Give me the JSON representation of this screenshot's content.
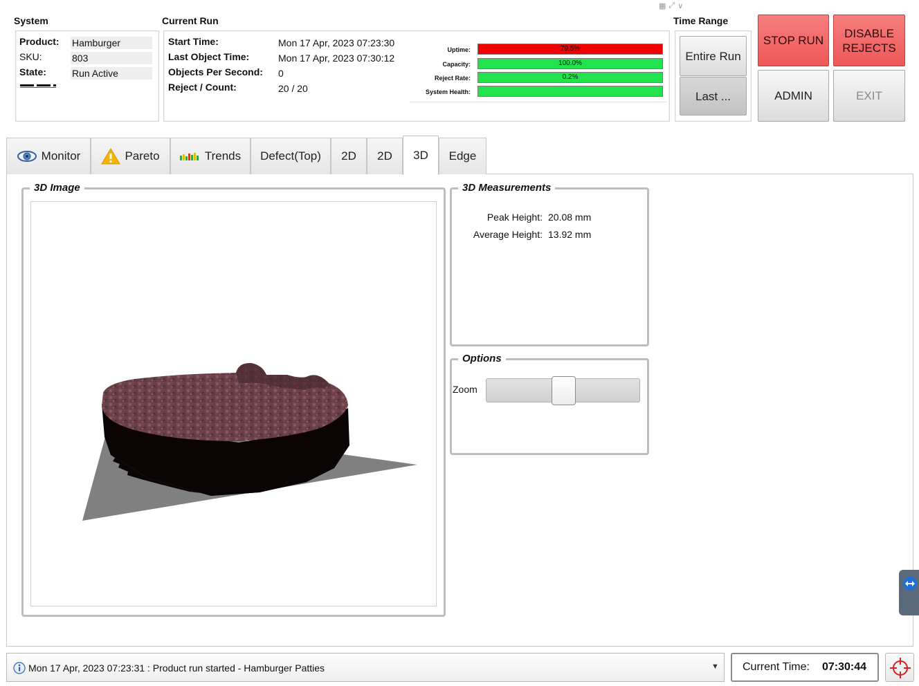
{
  "colors": {
    "accent_red": "#ee5757",
    "status_green": "#22e34d",
    "status_red": "#f00000",
    "panel_border": "#bdbdbd"
  },
  "system": {
    "title": "System",
    "product_label": "Product:",
    "product_value": "Hamburger Patties",
    "sku_label": "SKU:",
    "sku_value": "803",
    "state_label": "State:",
    "state_value": "Run Active"
  },
  "current_run": {
    "title": "Current Run",
    "start_time_label": "Start Time:",
    "start_time_value": "Mon 17 Apr, 2023 07:23:30",
    "last_object_label": "Last Object Time:",
    "last_object_value": "Mon 17 Apr, 2023 07:30:12",
    "ops_label": "Objects Per Second:",
    "ops_value": "0",
    "reject_label": "Reject / Count:",
    "reject_value": "20 / 20"
  },
  "metrics": [
    {
      "label": "Uptime:",
      "value_text": "79.5%",
      "color": "#f00000",
      "fraction": 1.0
    },
    {
      "label": "Capacity:",
      "value_text": "100.0%",
      "color": "#22e34d",
      "fraction": 1.0
    },
    {
      "label": "Reject Rate:",
      "value_text": "0.2%",
      "color": "#22e34d",
      "fraction": 1.0
    },
    {
      "label": "System Health:",
      "value_text": "",
      "color": "#22e34d",
      "fraction": 1.0
    }
  ],
  "time_range": {
    "title": "Time Range",
    "entire_run": "Entire Run",
    "last": "Last ..."
  },
  "buttons": {
    "stop_run": "STOP RUN",
    "disable_rejects": "DISABLE REJECTS",
    "admin": "ADMIN",
    "exit": "EXIT"
  },
  "tabs": [
    {
      "label": "Monitor",
      "icon": "eye-icon"
    },
    {
      "label": "Pareto",
      "icon": "warning-icon"
    },
    {
      "label": "Trends",
      "icon": "trends-icon"
    },
    {
      "label": "Defect(Top)",
      "icon": ""
    },
    {
      "label": "2D",
      "icon": ""
    },
    {
      "label": "2D",
      "icon": ""
    },
    {
      "label": "3D",
      "icon": "",
      "active": true
    },
    {
      "label": "Edge",
      "icon": ""
    }
  ],
  "image_panel": {
    "title": "3D Image"
  },
  "measurements": {
    "title": "3D Measurements",
    "peak_label": "Peak Height:",
    "peak_value": "20.08 mm",
    "avg_label": "Average Height:",
    "avg_value": "13.92 mm"
  },
  "options": {
    "title": "Options",
    "zoom_label": "Zoom",
    "zoom_level": 0.5
  },
  "status_bar": {
    "message": "Mon 17 Apr, 2023 07:23:31 : Product run started - Hamburger Patties"
  },
  "clock": {
    "label": "Current Time:",
    "value": "07:30:44"
  }
}
